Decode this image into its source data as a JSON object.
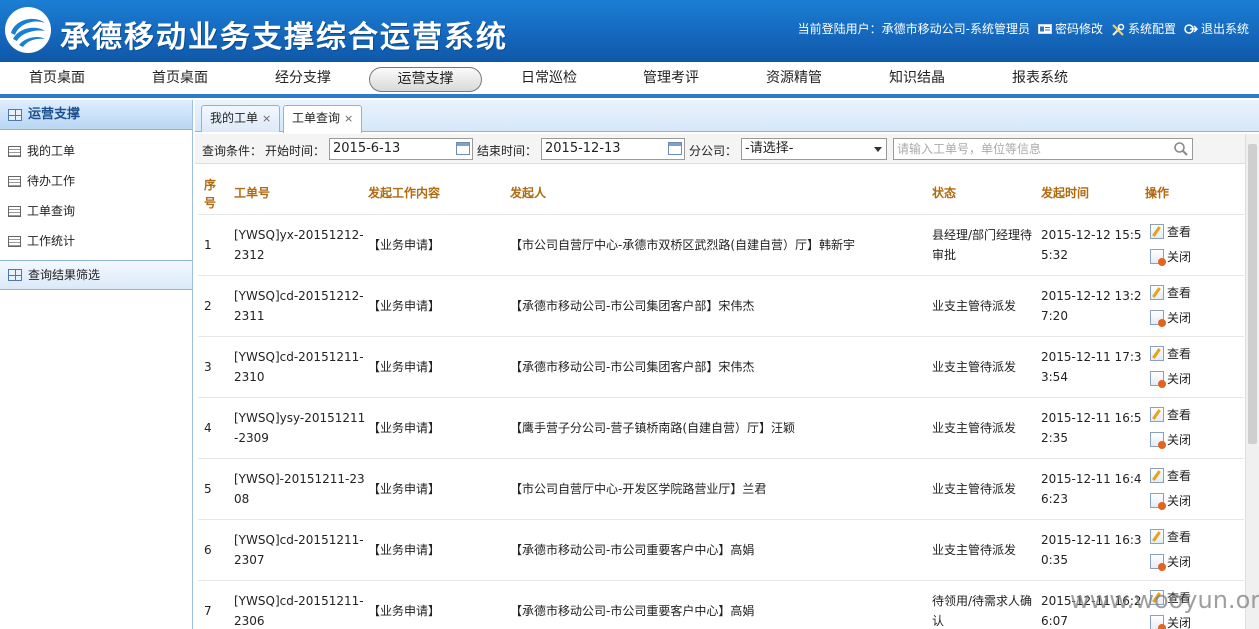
{
  "app": {
    "title": "承德移动业务支撑综合运营系统"
  },
  "userbar": {
    "current_user": "当前登陆用户：承德市移动公司-系统管理员",
    "password_change": "密码修改",
    "system_config": "系统配置",
    "logout": "退出系统"
  },
  "nav": {
    "items": [
      {
        "label": "首页桌面"
      },
      {
        "label": "首页桌面"
      },
      {
        "label": "经分支撑"
      },
      {
        "label": "运营支撑"
      },
      {
        "label": "日常巡检"
      },
      {
        "label": "管理考评"
      },
      {
        "label": "资源精管"
      },
      {
        "label": "知识结晶"
      },
      {
        "label": "报表系统"
      }
    ],
    "active_index": 3
  },
  "sidebar": {
    "section_title": "运营支撑",
    "items": [
      {
        "label": "我的工单"
      },
      {
        "label": "待办工作"
      },
      {
        "label": "工单查询"
      },
      {
        "label": "工作统计"
      }
    ],
    "filter_label": "查询结果筛选"
  },
  "tabs": [
    {
      "label": "我的工单",
      "close": "×"
    },
    {
      "label": "工单查询",
      "close": "×"
    }
  ],
  "filters": {
    "label_conditions": "查询条件：",
    "label_start": "开始时间：",
    "start_value": "2015-6-13",
    "label_end": "结束时间：",
    "end_value": "2015-12-13",
    "label_branch": "分公司：",
    "branch_value": "-请选择-",
    "search_placeholder": "请输入工单号，单位等信息"
  },
  "table": {
    "headers": {
      "index_1": "序",
      "index_2": "号",
      "ticket_no": "工单号",
      "content": "发起工作内容",
      "initiator": "发起人",
      "status": "状态",
      "time": "发起时间",
      "actions": "操作"
    },
    "view_label": "查看",
    "close_label": "关闭",
    "rows": [
      {
        "no": "1",
        "ticket_1": "[YWSQ]yx-20151212-",
        "ticket_2": "2312",
        "content": "【业务申请】",
        "initiator": "【市公司自营厅中心-承德市双桥区武烈路(自建自营）厅】韩新宇",
        "status_1": "县经理/部门经理待",
        "status_2": "审批",
        "time_1": "2015-12-12 15:5",
        "time_2": "5:32"
      },
      {
        "no": "2",
        "ticket_1": "[YWSQ]cd-20151212-",
        "ticket_2": "2311",
        "content": "【业务申请】",
        "initiator": "【承德市移动公司-市公司集团客户部】宋伟杰",
        "status_1": "业支主管待派发",
        "status_2": "",
        "time_1": "2015-12-12 13:2",
        "time_2": "7:20"
      },
      {
        "no": "3",
        "ticket_1": "[YWSQ]cd-20151211-",
        "ticket_2": "2310",
        "content": "【业务申请】",
        "initiator": "【承德市移动公司-市公司集团客户部】宋伟杰",
        "status_1": "业支主管待派发",
        "status_2": "",
        "time_1": "2015-12-11 17:3",
        "time_2": "3:54"
      },
      {
        "no": "4",
        "ticket_1": "[YWSQ]ysy-20151211",
        "ticket_2": "-2309",
        "content": "【业务申请】",
        "initiator": "【鹰手营子分公司-营子镇桥南路(自建自营）厅】汪颖",
        "status_1": "业支主管待派发",
        "status_2": "",
        "time_1": "2015-12-11 16:5",
        "time_2": "2:35"
      },
      {
        "no": "5",
        "ticket_1": "[YWSQ]-20151211-23",
        "ticket_2": "08",
        "content": "【业务申请】",
        "initiator": "【市公司自营厅中心-开发区学院路营业厅】兰君",
        "status_1": "业支主管待派发",
        "status_2": "",
        "time_1": "2015-12-11 16:4",
        "time_2": "6:23"
      },
      {
        "no": "6",
        "ticket_1": "[YWSQ]cd-20151211-",
        "ticket_2": "2307",
        "content": "【业务申请】",
        "initiator": "【承德市移动公司-市公司重要客户中心】高娟",
        "status_1": "业支主管待派发",
        "status_2": "",
        "time_1": "2015-12-11 16:3",
        "time_2": "0:35"
      },
      {
        "no": "7",
        "ticket_1": "[YWSQ]cd-20151211-",
        "ticket_2": "2306",
        "content": "【业务申请】",
        "initiator": "【承德市移动公司-市公司重要客户中心】高娟",
        "status_1": "待领用/待需求人确",
        "status_2": "认",
        "time_1": "2015-12-11 16:2",
        "time_2": "6:07"
      }
    ]
  },
  "watermark": "www.wooyun.org"
}
